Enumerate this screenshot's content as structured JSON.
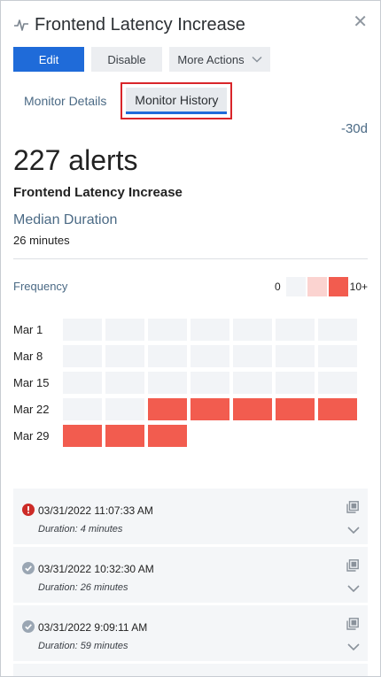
{
  "header": {
    "title": "Frontend Latency Increase"
  },
  "toolbar": {
    "edit_label": "Edit",
    "disable_label": "Disable",
    "more_label": "More Actions"
  },
  "tabs": {
    "details_label": "Monitor Details",
    "history_label": "Monitor History"
  },
  "range_label": "-30d",
  "summary": {
    "alert_count": "227 alerts",
    "monitor_name": "Frontend Latency Increase",
    "median_label": "Median Duration",
    "median_value": "26 minutes"
  },
  "frequency": {
    "label": "Frequency",
    "legend_min": "0",
    "legend_max": "10+",
    "colors": {
      "empty": "#f2f4f7",
      "low": "#fbd3d0",
      "high": "#f25c4f"
    },
    "weeks": [
      {
        "label": "Mar 1",
        "levels": [
          0,
          0,
          0,
          0,
          0,
          0,
          0
        ]
      },
      {
        "label": "Mar 8",
        "levels": [
          0,
          0,
          0,
          0,
          0,
          0,
          0
        ]
      },
      {
        "label": "Mar 15",
        "levels": [
          0,
          0,
          0,
          0,
          0,
          0,
          0
        ]
      },
      {
        "label": "Mar 22",
        "levels": [
          0,
          0,
          2,
          2,
          2,
          2,
          2
        ]
      },
      {
        "label": "Mar 29",
        "levels": [
          2,
          2,
          2
        ]
      }
    ]
  },
  "alerts": [
    {
      "status": "error",
      "time": "03/31/2022 11:07:33 AM",
      "duration": "Duration: 4 minutes"
    },
    {
      "status": "resolved",
      "time": "03/31/2022 10:32:30 AM",
      "duration": "Duration: 26 minutes"
    },
    {
      "status": "resolved",
      "time": "03/31/2022 9:09:11 AM",
      "duration": "Duration: 59 minutes"
    }
  ],
  "icons": {
    "title": "pulse-icon",
    "close": "close-icon",
    "more": "chevron-down-icon",
    "alert_open": "open-external-icon",
    "alert_expand": "chevron-down-icon",
    "error": "error-icon",
    "resolved": "check-circle-icon"
  },
  "accent": "#1f6bd9"
}
